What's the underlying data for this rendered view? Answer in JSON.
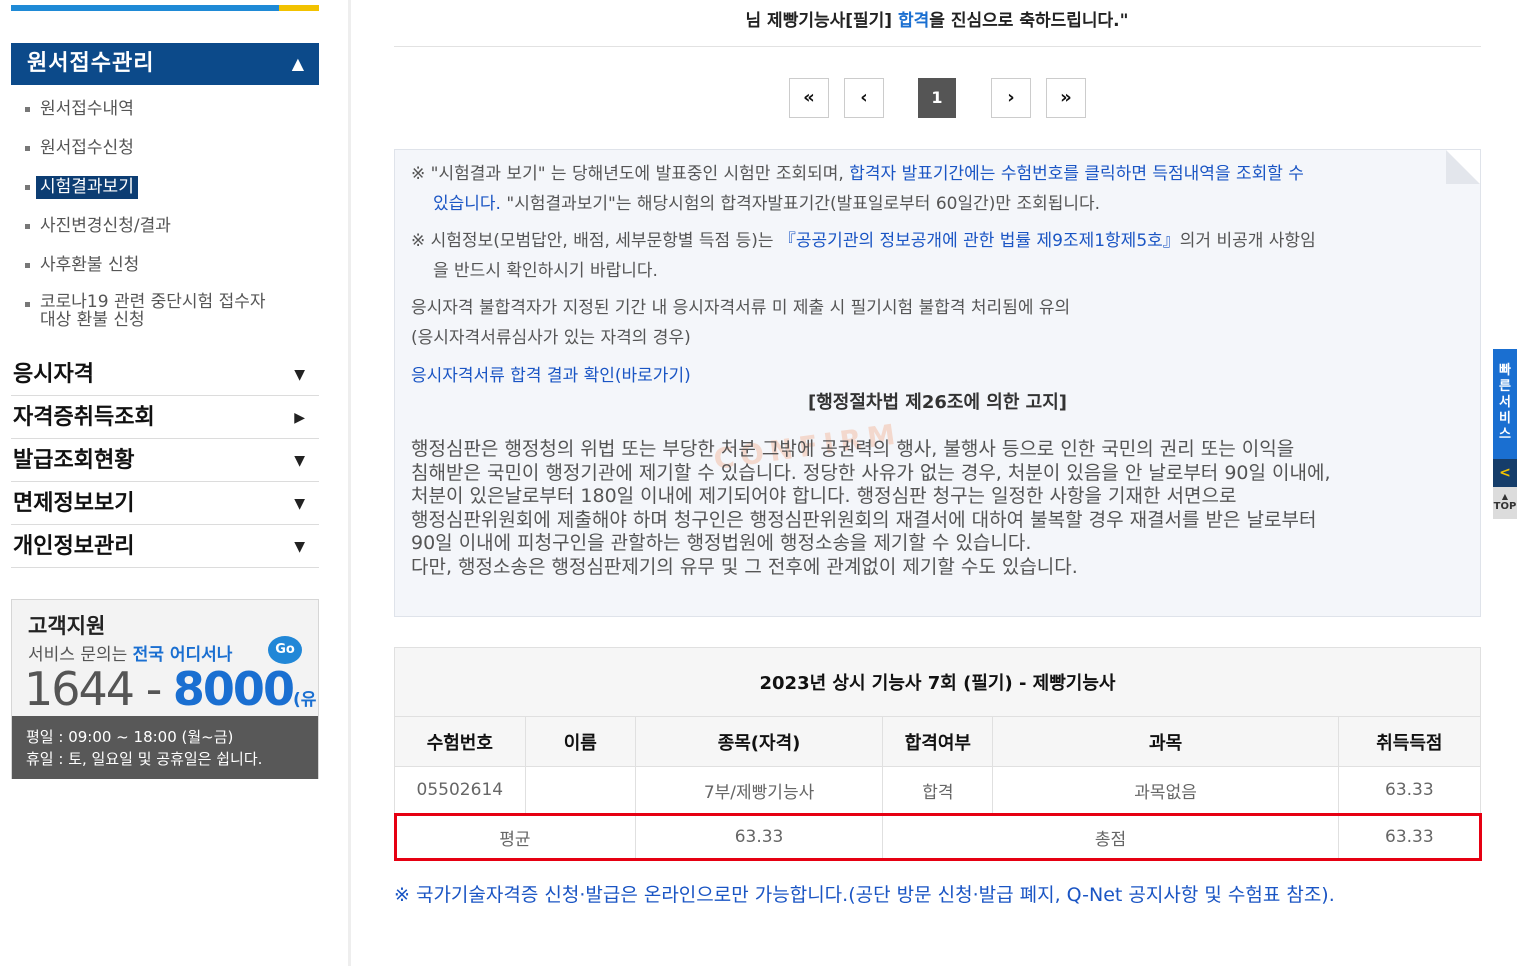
{
  "sidebar": {
    "menu_head": "원서접수관리",
    "submenu": [
      "원서접수내역",
      "원서접수신청",
      "시험결과보기",
      "사진변경신청/결과",
      "사후환불 신청",
      "코로나19 관련 중단시험 접수자",
      "대상 환불 신청"
    ],
    "categories": [
      "응시자격",
      "자격증취득조회",
      "발급조회현황",
      "면제정보보기",
      "개인정보관리"
    ],
    "support": {
      "title": "고객지원",
      "sub_prefix": "서비스 문의는 ",
      "sub_highlight": "전국 어디서나",
      "go": "Go",
      "phone_a": "1644 - ",
      "phone_b": "8000",
      "phone_note": "(유료)",
      "hours_1": "평일 : 09:00 ~ 18:00 (월~금)",
      "hours_2": "휴일 : 토, 일요일 및 공휴일은 쉽니다."
    }
  },
  "header": {
    "congrats_a": "님 제빵기능사[필기] ",
    "congrats_b": "합격",
    "congrats_c": "을 진심으로 축하드립니다.\""
  },
  "pager": {
    "first": "«",
    "prev": "‹",
    "current": "1",
    "next": "›",
    "last": "»"
  },
  "notice": {
    "l1a": "※ \"시험결과 보기\" 는 당해년도에 발표중인 시험만 조회되며, ",
    "l1b": "합격자 발표기간에는 수험번호를 클릭하면 득점내역을 조회할 수",
    "l2a": "있습니다.",
    "l2b": " \"시험결과보기\"는 해당시험의 합격자발표기간(발표일로부터 60일간)만 조회됩니다.",
    "l3a": "※ 시험정보(모범답안, 배점, 세부문항별 득점 등)는 ",
    "l3b": "『공공기관의 정보공개에 관한 법률 제9조제1항제5호』",
    "l3c": "의거 비공개 사항임",
    "l4": "을 반드시 확인하시기 바랍니다.",
    "l5": "응시자격 불합격자가 지정된 기간 내 응시자격서류 미 제출 시 필기시험 불합격 처리됨에 유의",
    "l6": "(응시자격서류심사가 있는 자격의 경우)",
    "l7": "응시자격서류 합격 결과 확인(바로가기)",
    "law_head": "[행정절차법 제26조에 의한 고지]",
    "para": [
      "행정심판은 행정청의 위법 또는 부당한 처분 그밖에 공권력의 행사, 불행사 등으로 인한 국민의 권리 또는 이익을",
      "침해받은 국민이 행정기관에 제기할 수 있습니다. 정당한 사유가 없는 경우, 처분이 있음을 안 날로부터 90일 이내에,",
      "처분이 있은날로부터 180일 이내에 제기되어야 합니다. 행정심판 청구는 일정한 사항을 기재한 서면으로",
      "행정심판위원회에 제출해야 하며 청구인은 행정심판위원회의 재결서에 대하여 불복할 경우 재결서를 받은 날로부터",
      "90일 이내에 피청구인을 관할하는 행정법원에 행정소송을 제기할 수 있습니다.",
      "다만, 행정소송은 행정심판제기의 유무 및 그 전후에 관계없이 제기할 수도 있습니다."
    ],
    "watermark": "CONFIRM"
  },
  "result": {
    "caption": "2023년 상시 기능사 7회 (필기) - 제빵기능사",
    "headers": [
      "수험번호",
      "이름",
      "종목(자격)",
      "합격여부",
      "과목",
      "취득득점"
    ],
    "row": [
      "05502614",
      "",
      "7부/제빵기능사",
      "합격",
      "과목없음",
      "63.33"
    ],
    "avg_label": "평균",
    "avg_value": "63.33",
    "total_label": "총점",
    "total_value": "63.33"
  },
  "footer_note": "※ 국가기술자격증 신청·발급은 온라인으로만 가능합니다.(공단 방문 신청·발급 폐지, Q-Net 공지사항 및 수험표 참조).",
  "quick": {
    "label": "빠른서비스",
    "arrow": "<",
    "top": "TOP"
  },
  "colors": {
    "brand": "#0c4a8a",
    "link": "#1a55c4",
    "highlight_border": "#e60012"
  }
}
